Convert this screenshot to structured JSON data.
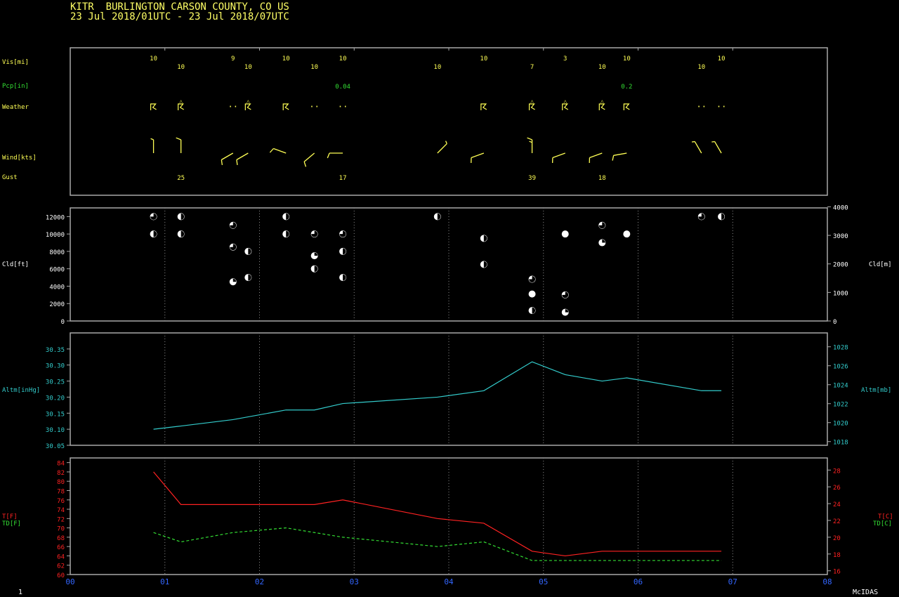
{
  "header": {
    "station": "KITR  BURLINGTON CARSON COUNTY, CO US",
    "period": "23 Jul 2018/01UTC - 23 Jul 2018/07UTC"
  },
  "footer": {
    "left": "1",
    "right": "McIDAS"
  },
  "colors": {
    "frame": "#a8a8a8",
    "grid": "#8c8c8c",
    "yellow": "#ffff55",
    "green": "#33dd33",
    "cyan": "#33cccc",
    "red": "#ff2222",
    "white": "#ffffff"
  },
  "chart_data": [
    {
      "type": "table",
      "panel": "observations",
      "time_ticks": [
        "00",
        "01",
        "02",
        "03",
        "04",
        "05",
        "06",
        "07",
        "08"
      ],
      "row_labels": {
        "vis": "Vis[mi]",
        "pcp": "Pcp[in]",
        "weather": "Weather",
        "wind": "Wind[kts]",
        "gust": "Gust"
      },
      "obs": [
        {
          "t": 0.88,
          "vis": "10",
          "vis_row": 0,
          "weather": "ts",
          "wind": {
            "dir": 360,
            "spd": 5
          }
        },
        {
          "t": 1.17,
          "vis": "10",
          "vis_row": 1,
          "weather": "ts-rain",
          "wind": {
            "dir": 360,
            "spd": 10
          },
          "gust": "25"
        },
        {
          "t": 1.72,
          "vis": "9",
          "vis_row": 0,
          "weather": "haze",
          "wind": {
            "dir": 240,
            "spd": 10
          }
        },
        {
          "t": 1.88,
          "vis": "10",
          "vis_row": 1,
          "weather": "ts-rain",
          "wind": {
            "dir": 240,
            "spd": 10
          }
        },
        {
          "t": 2.28,
          "vis": "10",
          "vis_row": 0,
          "weather": "ts",
          "wind": {
            "dir": 290,
            "spd": 10
          }
        },
        {
          "t": 2.58,
          "vis": "10",
          "vis_row": 1,
          "weather": "haze",
          "wind": {
            "dir": 230,
            "spd": 10
          }
        },
        {
          "t": 2.88,
          "vis": "10",
          "vis_row": 0,
          "pcp": "0.04",
          "weather": "haze",
          "wind": {
            "dir": 270,
            "spd": 10
          },
          "gust": "17"
        },
        {
          "t": 3.88,
          "vis": "10",
          "vis_row": 1,
          "wind": {
            "dir": 45,
            "spd": 5
          }
        },
        {
          "t": 4.37,
          "vis": "10",
          "vis_row": 0,
          "weather": "ts",
          "wind": {
            "dir": 250,
            "spd": 10
          }
        },
        {
          "t": 4.88,
          "vis": "7",
          "vis_row": 1,
          "weather": "ts-rain",
          "wind": {
            "dir": 360,
            "spd": 15
          },
          "gust": "39"
        },
        {
          "t": 5.23,
          "vis": "3",
          "vis_row": 0,
          "weather": "ts-rain",
          "wind": {
            "dir": 250,
            "spd": 10
          }
        },
        {
          "t": 5.62,
          "vis": "10",
          "vis_row": 1,
          "weather": "ts-rain",
          "wind": {
            "dir": 250,
            "spd": 10
          },
          "gust": "18"
        },
        {
          "t": 5.88,
          "vis": "10",
          "vis_row": 0,
          "pcp": "0.2",
          "weather": "ts",
          "wind": {
            "dir": 260,
            "spd": 10
          }
        },
        {
          "t": 6.67,
          "vis": "10",
          "vis_row": 1,
          "weather": "haze",
          "wind": {
            "dir": 330,
            "spd": 5
          }
        },
        {
          "t": 6.88,
          "vis": "10",
          "vis_row": 0,
          "weather": "haze",
          "wind": {
            "dir": 330,
            "spd": 5
          }
        }
      ]
    },
    {
      "type": "scatter",
      "panel": "clouds",
      "ylabel": "Cld[ft]",
      "y2label": "Cld[m]",
      "ylim": [
        0,
        13000
      ],
      "yticks": [
        0,
        2000,
        4000,
        6000,
        8000,
        10000,
        12000
      ],
      "y2ticks": [
        0,
        1000,
        2000,
        3000,
        4000
      ],
      "points": [
        {
          "t": 0.88,
          "ft": 12000,
          "cov": "bkn"
        },
        {
          "t": 0.88,
          "ft": 10000,
          "cov": "sct"
        },
        {
          "t": 1.17,
          "ft": 12000,
          "cov": "sct"
        },
        {
          "t": 1.17,
          "ft": 10000,
          "cov": "sct"
        },
        {
          "t": 1.72,
          "ft": 11000,
          "cov": "bkn"
        },
        {
          "t": 1.72,
          "ft": 8500,
          "cov": "bkn"
        },
        {
          "t": 1.72,
          "ft": 4500,
          "cov": "few"
        },
        {
          "t": 1.88,
          "ft": 8000,
          "cov": "sct"
        },
        {
          "t": 1.88,
          "ft": 5000,
          "cov": "sct"
        },
        {
          "t": 2.28,
          "ft": 12000,
          "cov": "sct"
        },
        {
          "t": 2.28,
          "ft": 10000,
          "cov": "sct"
        },
        {
          "t": 2.58,
          "ft": 10000,
          "cov": "bkn"
        },
        {
          "t": 2.58,
          "ft": 7500,
          "cov": "few"
        },
        {
          "t": 2.58,
          "ft": 6000,
          "cov": "sct"
        },
        {
          "t": 2.88,
          "ft": 10000,
          "cov": "bkn"
        },
        {
          "t": 2.88,
          "ft": 8000,
          "cov": "sct"
        },
        {
          "t": 2.88,
          "ft": 5000,
          "cov": "sct"
        },
        {
          "t": 3.88,
          "ft": 12000,
          "cov": "sct"
        },
        {
          "t": 4.37,
          "ft": 9500,
          "cov": "sct"
        },
        {
          "t": 4.37,
          "ft": 6500,
          "cov": "sct"
        },
        {
          "t": 4.88,
          "ft": 4800,
          "cov": "bkn"
        },
        {
          "t": 4.88,
          "ft": 3100,
          "cov": "ovc"
        },
        {
          "t": 4.88,
          "ft": 1200,
          "cov": "sct"
        },
        {
          "t": 5.23,
          "ft": 10000,
          "cov": "ovc"
        },
        {
          "t": 5.23,
          "ft": 3000,
          "cov": "bkn"
        },
        {
          "t": 5.23,
          "ft": 1000,
          "cov": "few"
        },
        {
          "t": 5.62,
          "ft": 11000,
          "cov": "bkn"
        },
        {
          "t": 5.62,
          "ft": 9000,
          "cov": "few"
        },
        {
          "t": 5.88,
          "ft": 10000,
          "cov": "ovc"
        },
        {
          "t": 6.67,
          "ft": 12000,
          "cov": "bkn"
        },
        {
          "t": 6.88,
          "ft": 12000,
          "cov": "sct"
        }
      ]
    },
    {
      "type": "line",
      "panel": "altimeter",
      "ylabel": "Altm[inHg]",
      "y2label": "Altm[mb]",
      "ylim": [
        30.05,
        30.4
      ],
      "yticks": [
        "30.05",
        "30.10",
        "30.15",
        "30.20",
        "30.25",
        "30.30",
        "30.35"
      ],
      "y2ticks": [
        1018,
        1020,
        1022,
        1024,
        1026,
        1028
      ],
      "x": [
        0.88,
        1.17,
        1.72,
        2.28,
        2.58,
        2.88,
        3.88,
        4.37,
        4.88,
        5.23,
        5.62,
        5.88,
        6.67,
        6.88
      ],
      "values": [
        30.1,
        30.11,
        30.13,
        30.16,
        30.16,
        30.18,
        30.2,
        30.22,
        30.31,
        30.27,
        30.25,
        30.26,
        30.22,
        30.22
      ]
    },
    {
      "type": "line",
      "panel": "temperature",
      "ylabel_t": "T[F]",
      "ylabel_td": "TD[F]",
      "y2label_t": "T[C]",
      "y2label_td": "TD[C]",
      "ylim": [
        60,
        85
      ],
      "yticks": [
        60,
        62,
        64,
        66,
        68,
        70,
        72,
        74,
        76,
        78,
        80,
        82,
        84
      ],
      "y2ticks": [
        16,
        18,
        20,
        22,
        24,
        26,
        28
      ],
      "series": [
        {
          "name": "T",
          "x": [
            0.88,
            1.17,
            2.58,
            2.88,
            3.88,
            4.37,
            4.88,
            5.23,
            5.62,
            5.88,
            6.67,
            6.88
          ],
          "values": [
            82,
            75,
            75,
            76,
            72,
            71,
            65,
            64,
            65,
            65,
            65,
            65
          ]
        },
        {
          "name": "TD",
          "x": [
            0.88,
            1.17,
            1.72,
            2.28,
            2.58,
            2.88,
            3.88,
            4.37,
            4.88,
            5.23,
            5.62,
            5.88,
            6.67,
            6.88
          ],
          "values": [
            69,
            67,
            69,
            70,
            69,
            68,
            66,
            67,
            63,
            63,
            63,
            63,
            63,
            63
          ]
        }
      ]
    }
  ]
}
